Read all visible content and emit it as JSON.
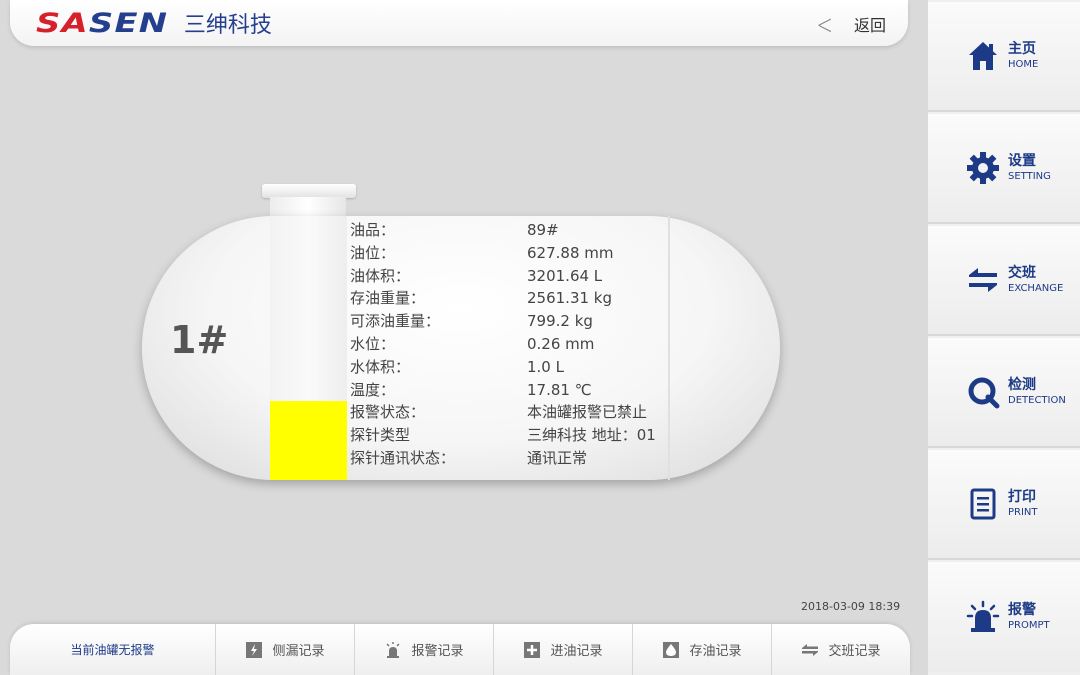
{
  "header": {
    "logo_part1": "SA",
    "logo_part2": "SEN",
    "logo_cn": "三绅科技",
    "back_label": "返回"
  },
  "sidebar": {
    "items": [
      {
        "cn": "主页",
        "en": "HOME",
        "icon": "home-icon"
      },
      {
        "cn": "设置",
        "en": "SETTING",
        "icon": "gear-icon"
      },
      {
        "cn": "交班",
        "en": "EXCHANGE",
        "icon": "exchange-icon"
      },
      {
        "cn": "检测",
        "en": "DETECTION",
        "icon": "detection-icon"
      },
      {
        "cn": "打印",
        "en": "PRINT",
        "icon": "print-icon"
      },
      {
        "cn": "报警",
        "en": "PROMPT",
        "icon": "alarm-icon"
      }
    ]
  },
  "tank": {
    "label": "1#",
    "level_fraction": 0.3,
    "fill_color": "#ffff00",
    "info": [
      {
        "key": "油品：",
        "value": "89#"
      },
      {
        "key": "油位：",
        "value": "627.88 mm"
      },
      {
        "key": "油体积：",
        "value": "3201.64 L"
      },
      {
        "key": "存油重量：",
        "value": "2561.31 kg"
      },
      {
        "key": "可添油重量：",
        "value": "799.2 kg"
      },
      {
        "key": "水位：",
        "value": "0.26 mm"
      },
      {
        "key": "水体积：",
        "value": "1.0 L"
      },
      {
        "key": "温度：",
        "value": "17.81 ℃"
      },
      {
        "key": "报警状态：",
        "value": "本油罐报警已禁止"
      },
      {
        "key": "探针类型",
        "value": "三绅科技 地址：01"
      },
      {
        "key": "探针通讯状态：",
        "value": "通讯正常"
      }
    ]
  },
  "timestamp": "2018-03-09 18:39",
  "bottom": {
    "status": "当前油罐无报警",
    "buttons": [
      {
        "label": "侧漏记录",
        "icon": "leak-icon"
      },
      {
        "label": "报警记录",
        "icon": "alarm-record-icon"
      },
      {
        "label": "进油记录",
        "icon": "oil-in-icon"
      },
      {
        "label": "存油记录",
        "icon": "oil-storage-icon"
      },
      {
        "label": "交班记录",
        "icon": "exchange-record-icon"
      }
    ]
  },
  "colors": {
    "brand_blue": "#1d3a86",
    "brand_red": "#d6202a"
  }
}
